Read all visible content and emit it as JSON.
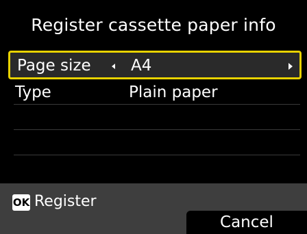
{
  "screen": {
    "title": "Register cassette paper info"
  },
  "settings": [
    {
      "label": "Page size",
      "value": "A4",
      "selected": true
    },
    {
      "label": "Type",
      "value": "Plain paper",
      "selected": false
    }
  ],
  "footer": {
    "ok_key_label": "OK",
    "ok_action_label": "Register",
    "cancel_label": "Cancel"
  },
  "colors": {
    "background": "#000000",
    "selection_border": "#e8d200",
    "footer_bar": "#3e3e3e"
  }
}
